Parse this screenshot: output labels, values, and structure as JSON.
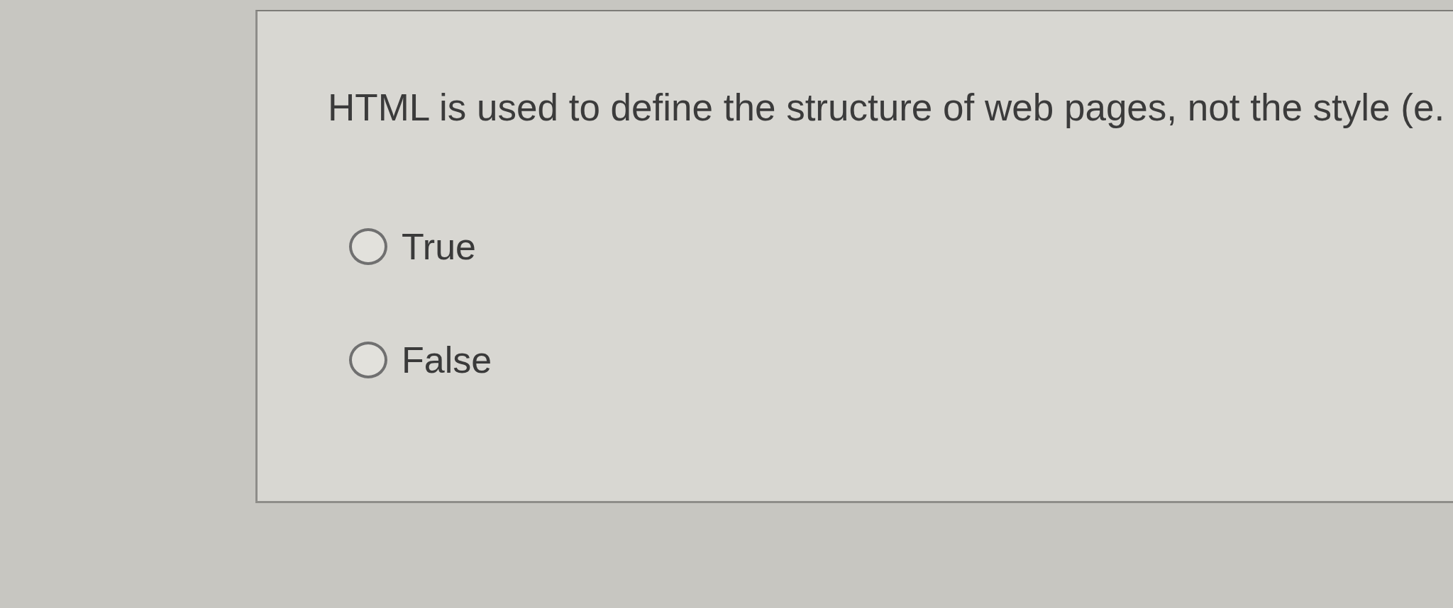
{
  "question": {
    "text": "HTML is used to define the structure of web pages, not the style (e.",
    "options": [
      {
        "label": "True",
        "selected": false
      },
      {
        "label": "False",
        "selected": false
      }
    ]
  }
}
